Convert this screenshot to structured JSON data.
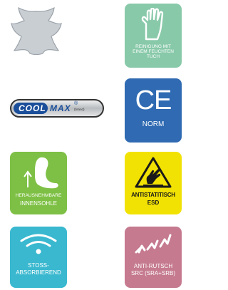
{
  "colors": {
    "leather_gray": "#c9ced3",
    "green_tile": "#88c9a9",
    "blue_tile": "#2f6ab2",
    "lime_tile": "#7ec045",
    "yellow_tile": "#f2e203",
    "cyan_tile": "#39b8cf",
    "mauve_tile": "#c57a8f",
    "coolmax_blue": "#1a4e9a"
  },
  "icons": {
    "leather": {
      "icon": "leather-hide-icon"
    },
    "cleaning": {
      "icon": "hand-icon",
      "label": "REINIGUNG MIT EINEM FEUCHTEN TUCH"
    },
    "coolmax": {
      "icon": "coolmax-logo",
      "brand_part1": "COOL",
      "brand_part2": "MAX",
      "reg": "®",
      "sub": "(brand)"
    },
    "ce": {
      "icon": "ce-mark-icon",
      "mark": "CE",
      "label": "NORM"
    },
    "insole": {
      "icon": "removable-insole-icon",
      "label_line1": "HERAUSNEHMBARE",
      "label_line2": "INNENSOHLE"
    },
    "esd": {
      "icon": "esd-hand-icon",
      "label_line1": "ANTISTATITISCH",
      "label_line2": "ESD"
    },
    "shock": {
      "icon": "shock-absorbing-icon",
      "label_line1": "STOSS-",
      "label_line2": "ABSORBIEREND"
    },
    "antislip": {
      "icon": "anti-slip-icon",
      "label_line1": "ANTI-RUTSCH",
      "label_line2": "SRC (SRA+SRB)"
    }
  }
}
